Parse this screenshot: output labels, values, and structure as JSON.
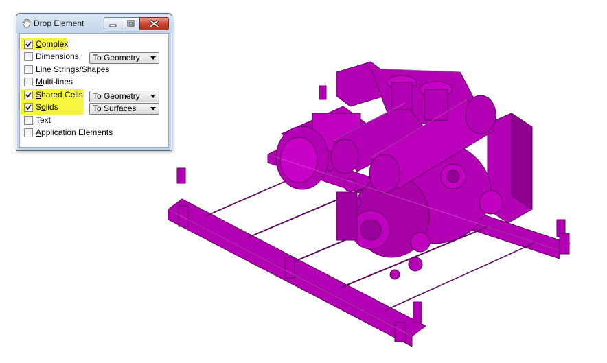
{
  "window": {
    "title": "Drop Element",
    "icon": "hand-icon",
    "controls": [
      "minimize-icon",
      "restore-icon",
      "close-icon"
    ]
  },
  "options": [
    {
      "pre": "",
      "mn": "C",
      "post": "omplex",
      "checked": true,
      "highlighted": true
    },
    {
      "pre": "",
      "mn": "D",
      "post": "imensions",
      "checked": false,
      "highlighted": false,
      "dropdown": "To Geometry"
    },
    {
      "pre": "",
      "mn": "L",
      "post": "ine Strings/Shapes",
      "checked": false,
      "highlighted": false
    },
    {
      "pre": "",
      "mn": "M",
      "post": "ulti-lines",
      "checked": false,
      "highlighted": false
    },
    {
      "pre": "",
      "mn": "S",
      "post": "hared Cells",
      "checked": true,
      "highlighted": true,
      "dropdown": "To Geometry"
    },
    {
      "pre": "S",
      "mn": "o",
      "post": "lids",
      "checked": true,
      "highlighted": true,
      "dropdown": "To Surfaces"
    },
    {
      "pre": "",
      "mn": "T",
      "post": "ext",
      "checked": false,
      "highlighted": false
    },
    {
      "pre": "",
      "mn": "A",
      "post": "pplication Elements",
      "checked": false,
      "highlighted": false
    }
  ],
  "colors": {
    "highlight": "#f6f63e",
    "model": "#b400b4",
    "model_dark": "#7a007a"
  },
  "model": {
    "name": "pump-assembly-3d-model"
  }
}
